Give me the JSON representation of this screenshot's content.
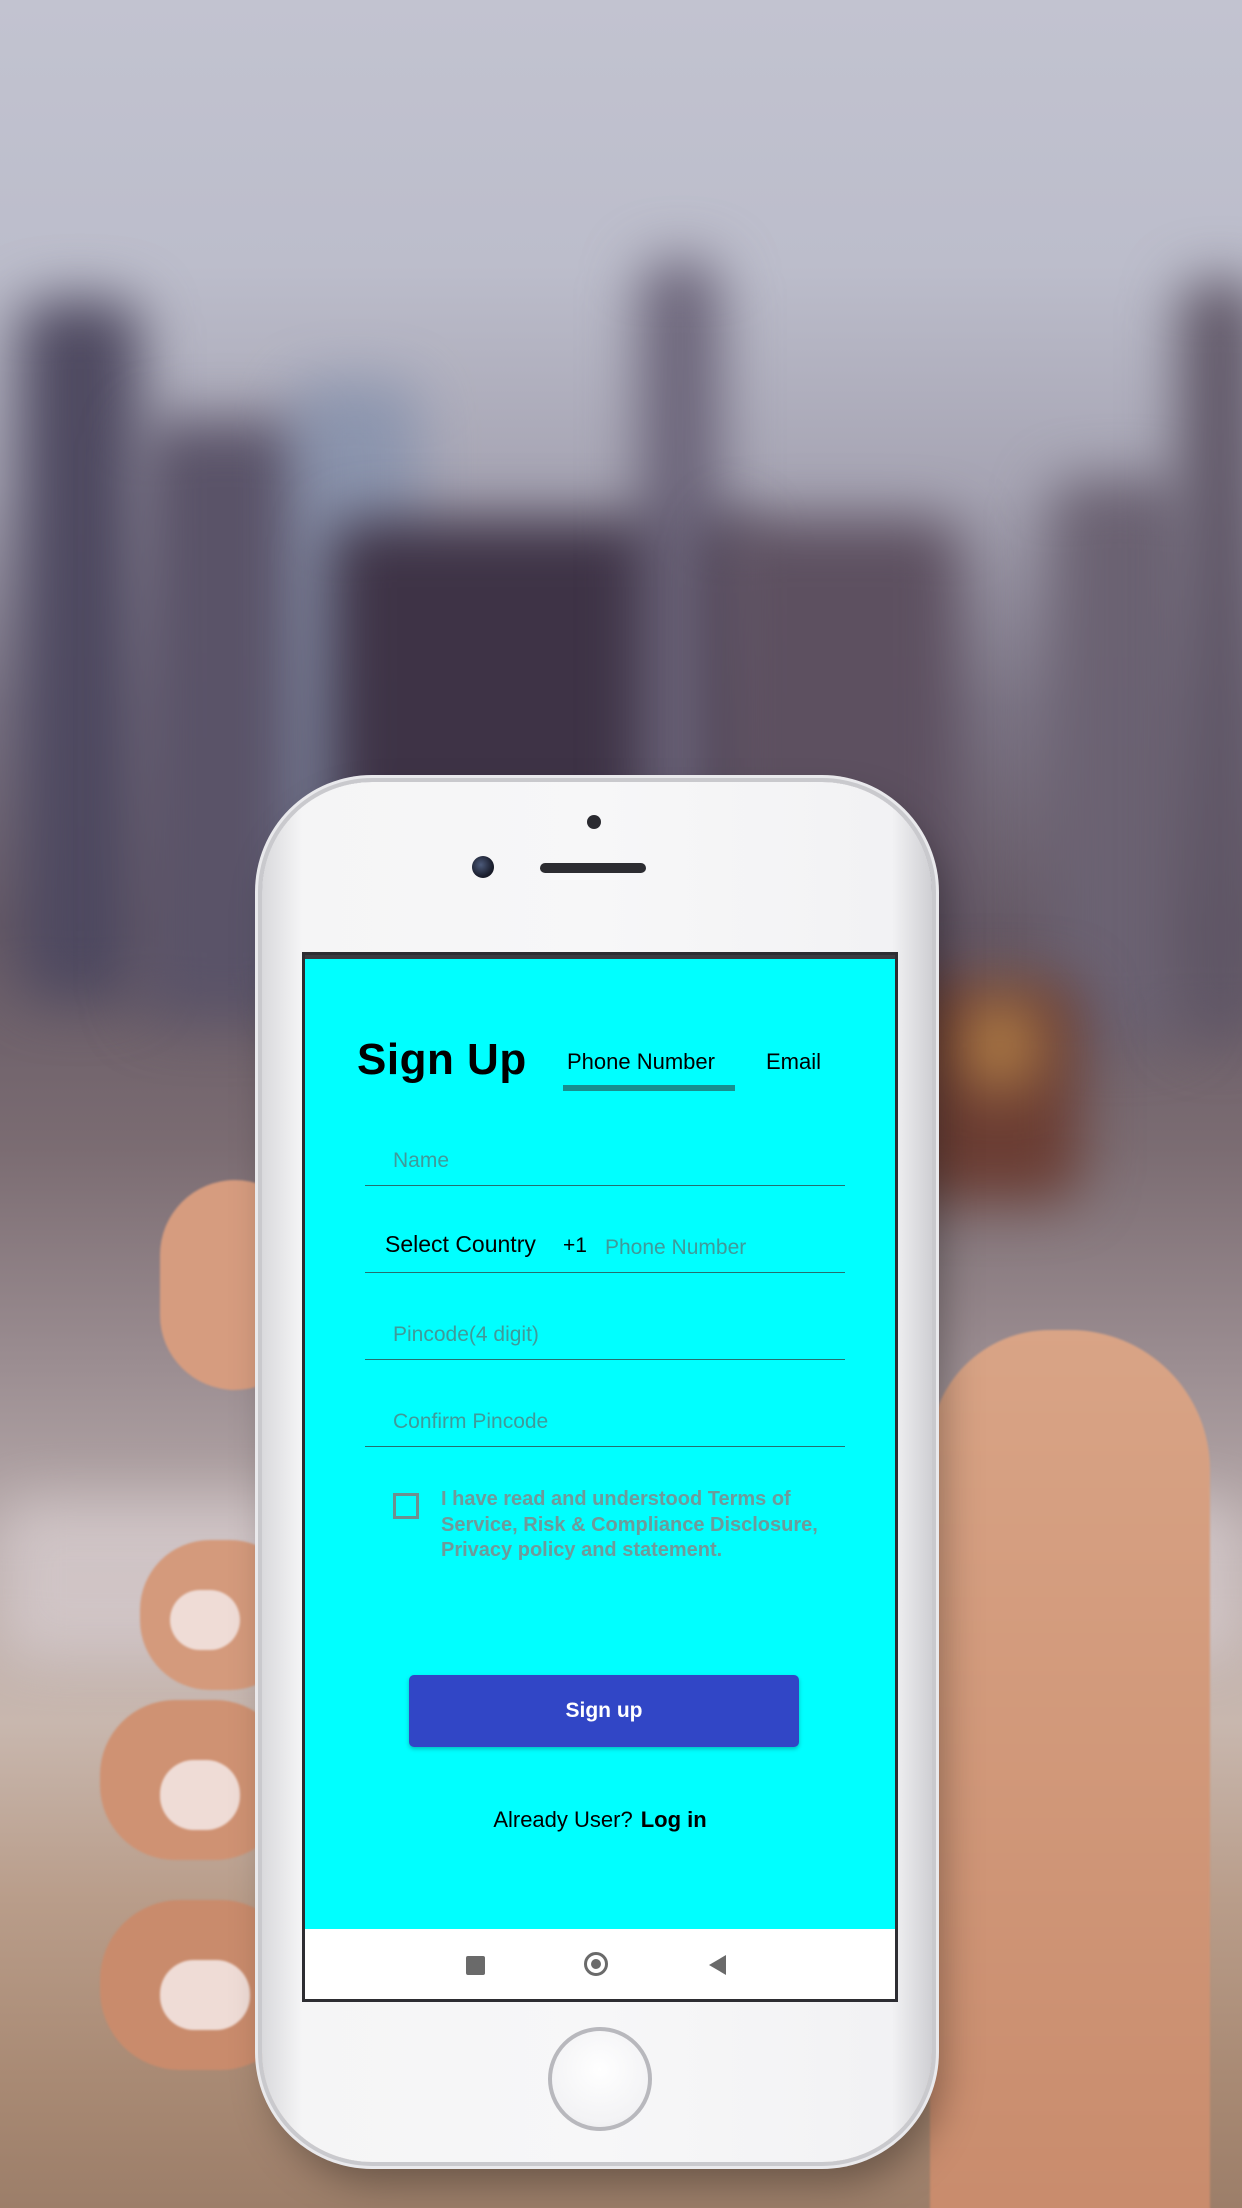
{
  "screen": {
    "title": "Sign Up",
    "tabs": [
      {
        "label": "Phone Number",
        "active": true
      },
      {
        "label": "Email",
        "active": false
      }
    ],
    "fields": {
      "name": {
        "placeholder": "Name",
        "value": ""
      },
      "phone": {
        "select_country_label": "Select Country",
        "dial_code": "+1",
        "placeholder": "Phone Number",
        "value": ""
      },
      "pincode": {
        "placeholder": "Pincode(4 digit)",
        "value": ""
      },
      "confirm_pincode": {
        "placeholder": "Confirm Pincode",
        "value": ""
      }
    },
    "terms": {
      "checked": false,
      "text": "I have read and understood Terms of Service, Risk & Compliance Disclosure, Privacy policy and statement."
    },
    "signup_button": "Sign up",
    "already_user": "Already User?",
    "login_link": "Log in"
  },
  "navbar": {
    "icons": [
      "recent-apps-icon",
      "home-icon",
      "back-icon"
    ]
  },
  "colors": {
    "screen_background": "#00ffff",
    "button": "#3146c6",
    "tab_indicator": "#178f8f",
    "placeholder": "#3f9a9a"
  }
}
